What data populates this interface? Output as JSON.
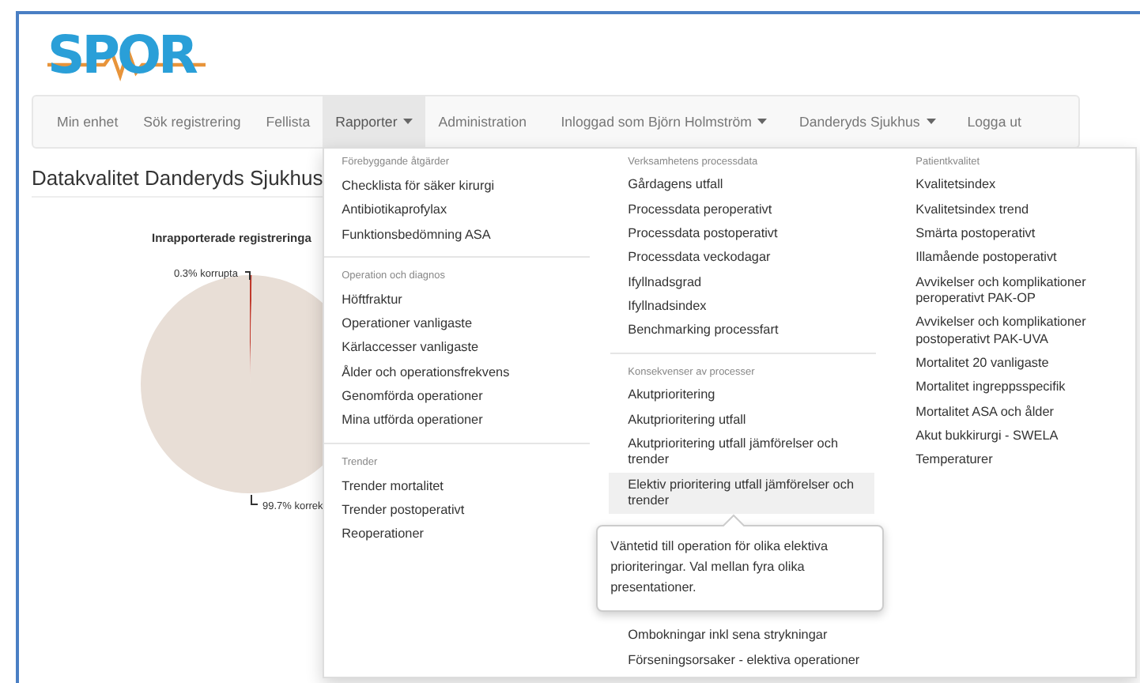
{
  "logo": {
    "text": "SPOR"
  },
  "nav": {
    "left": [
      {
        "label": "Min enhet",
        "selected": false,
        "caret": false
      },
      {
        "label": "Sök registrering",
        "selected": false,
        "caret": false
      },
      {
        "label": "Fellista",
        "selected": false,
        "caret": false
      },
      {
        "label": "Rapporter",
        "selected": true,
        "caret": true
      },
      {
        "label": "Administration",
        "selected": false,
        "caret": false
      }
    ],
    "right": [
      {
        "label": "Inloggad som Björn Holmström",
        "caret": true
      },
      {
        "label": "Danderyds Sjukhus",
        "caret": true
      },
      {
        "label": "Logga ut",
        "caret": false
      }
    ]
  },
  "heading": "Datakvalitet Danderyds Sjukhus",
  "chart": {
    "chart_data": {
      "type": "pie",
      "title": "Inrapporterade registreringa",
      "categories": [
        "0.3% korrupta",
        "99.7% korrek"
      ],
      "values": [
        0.3,
        99.7
      ]
    }
  },
  "menu": {
    "columns": [
      {
        "groups": [
          {
            "header": "Förebyggande åtgärder",
            "items": [
              {
                "label": "Checklista för säker kirurgi",
                "selected": false
              },
              {
                "label": "Antibiotikaprofylax",
                "selected": false
              },
              {
                "label": "Funktionsbedömning ASA",
                "selected": false
              }
            ]
          },
          {
            "header": "Operation och diagnos",
            "items": [
              {
                "label": "Höftfraktur",
                "selected": false
              },
              {
                "label": "Operationer vanligaste",
                "selected": false
              },
              {
                "label": "Kärlaccesser vanligaste",
                "selected": false
              },
              {
                "label": "Ålder och operationsfrekvens",
                "selected": false
              },
              {
                "label": "Genomförda operationer",
                "selected": false
              },
              {
                "label": "Mina utförda operationer",
                "selected": false
              }
            ]
          },
          {
            "header": "Trender",
            "items": [
              {
                "label": "Trender mortalitet",
                "selected": false
              },
              {
                "label": "Trender postoperativt",
                "selected": false
              },
              {
                "label": "Reoperationer",
                "selected": false
              }
            ]
          }
        ]
      },
      {
        "groups": [
          {
            "header": "Verksamhetens processdata",
            "items": [
              {
                "label": "Gårdagens utfall",
                "selected": false
              },
              {
                "label": "Processdata peroperativt",
                "selected": false
              },
              {
                "label": "Processdata postoperativt",
                "selected": false
              },
              {
                "label": "Processdata veckodagar",
                "selected": false
              },
              {
                "label": "Ifyllnadsgrad",
                "selected": false
              },
              {
                "label": "Ifyllnadsindex",
                "selected": false
              },
              {
                "label": "Benchmarking processfart",
                "selected": false
              }
            ]
          },
          {
            "header": "Konsekvenser av processer",
            "items": [
              {
                "label": "Akutprioritering",
                "selected": false
              },
              {
                "label": "Akutprioritering utfall",
                "selected": false
              },
              {
                "label": "Akutprioritering utfall jämförelser och trender",
                "selected": false
              },
              {
                "label": "Elektiv prioritering utfall jämförelser och trender",
                "selected": true,
                "tooltip": "Väntetid till operation för olika elektiva prioriteringar. Val mellan fyra olika presentationer."
              },
              {
                "label": "Ombokningar inkl sena strykningar",
                "selected": false
              },
              {
                "label": "Förseningsorsaker - elektiva operationer",
                "selected": false
              }
            ]
          }
        ]
      },
      {
        "groups": [
          {
            "header": "Patientkvalitet",
            "items": [
              {
                "label": "Kvalitetsindex",
                "selected": false
              },
              {
                "label": "Kvalitetsindex trend",
                "selected": false
              },
              {
                "label": "Smärta postoperativt",
                "selected": false
              },
              {
                "label": "Illamående postoperativt",
                "selected": false
              },
              {
                "label": "Avvikelser och komplikationer peroperativt PAK-OP",
                "selected": false
              },
              {
                "label": "Avvikelser och komplikationer postoperativt PAK-UVA",
                "selected": false
              },
              {
                "label": "Mortalitet 20 vanligaste",
                "selected": false
              },
              {
                "label": "Mortalitet ingreppsspecifik",
                "selected": false
              },
              {
                "label": "Mortalitet ASA och ålder",
                "selected": false
              },
              {
                "label": "Akut bukkirurgi - SWELA",
                "selected": false
              },
              {
                "label": "Temperaturer",
                "selected": false
              }
            ]
          }
        ]
      }
    ]
  }
}
